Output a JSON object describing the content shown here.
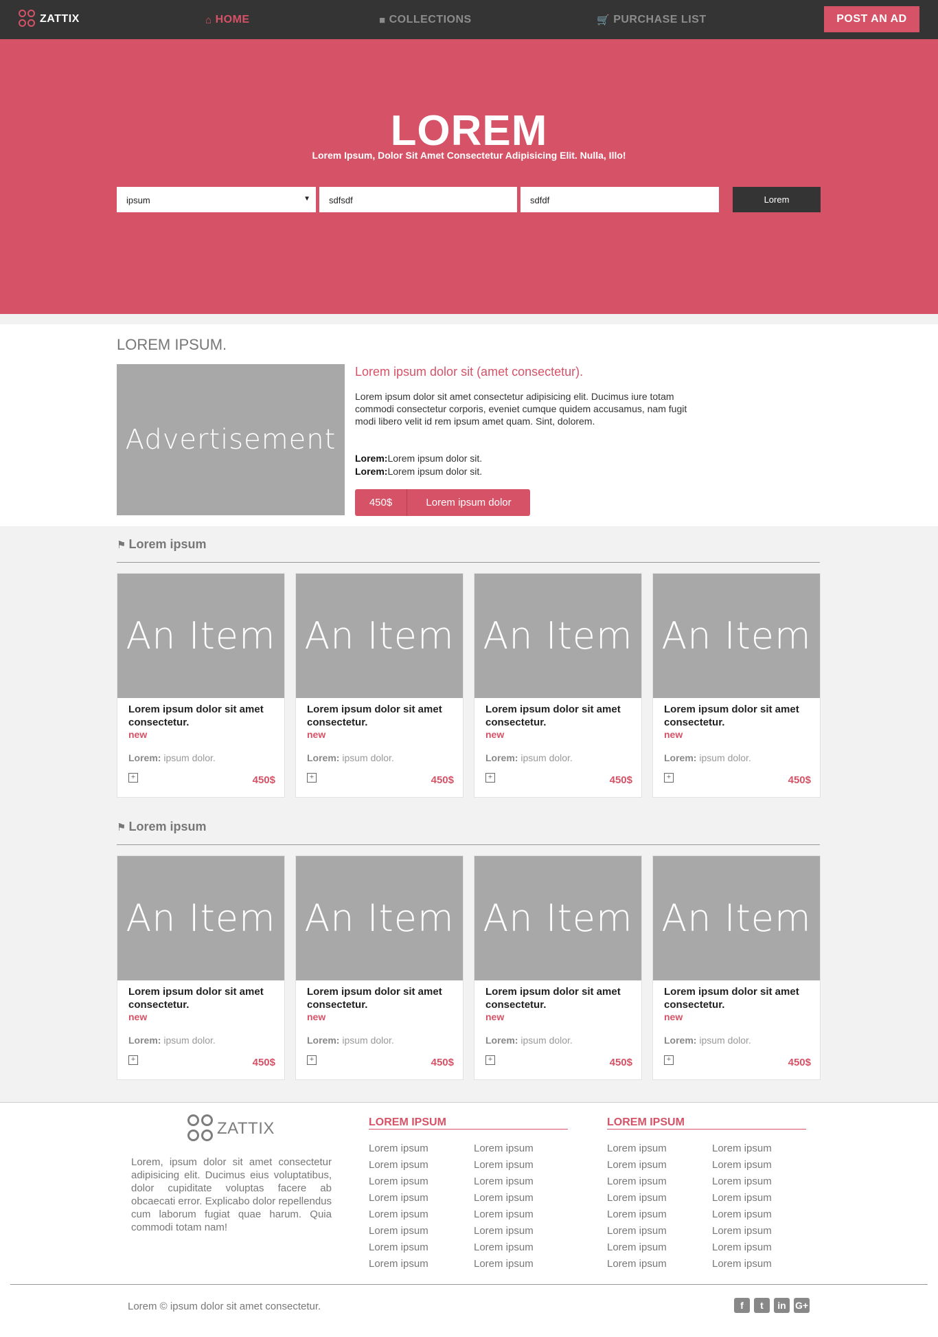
{
  "brand": {
    "name": "ZATTIX",
    "accent": "#d65266",
    "dark": "#343434"
  },
  "nav": {
    "home": "HOME",
    "collections": "COLLECTIONS",
    "purchase_list": "PURCHASE LIST",
    "post_ad": "POST AN AD",
    "icons": {
      "home": "home-icon",
      "collections": "square-icon",
      "purchase_list": "cart-icon"
    }
  },
  "hero": {
    "title": "LOREM",
    "subtitle": "Lorem Ipsum, Dolor Sit Amet Consectetur Adipisicing Elit. Nulla, Illo!",
    "select_value": "ipsum",
    "input1_value": "sdfsdf",
    "input2_value": "sdfdf",
    "button": "Lorem"
  },
  "featured": {
    "heading": "LOREM IPSUM.",
    "ad_label": "Advertisement",
    "title": "Lorem ipsum dolor sit (amet consectetur).",
    "description": "Lorem ipsum dolor sit amet consectetur adipisicing elit. Ducimus iure totam commodi consectetur corporis, eveniet cumque quidem accusamus, nam fugit modi libero velit id rem ipsum amet quam. Sint, dolorem.",
    "detail1_label": "Lorem:",
    "detail1_value": "Lorem ipsum dolor sit.",
    "detail2_label": "Lorem:",
    "detail2_value": "Lorem ipsum dolor sit.",
    "price": "450$",
    "cta": "Lorem ipsum dolor"
  },
  "sections": [
    {
      "title": "Lorem ipsum",
      "items": [
        {
          "image_label": "An Item",
          "title": "Lorem ipsum dolor sit amet consectetur.",
          "tag": "new",
          "meta_label": "Lorem:",
          "meta_value": "ipsum dolor.",
          "price": "450$"
        },
        {
          "image_label": "An Item",
          "title": "Lorem ipsum dolor sit amet consectetur.",
          "tag": "new",
          "meta_label": "Lorem:",
          "meta_value": "ipsum dolor.",
          "price": "450$"
        },
        {
          "image_label": "An Item",
          "title": "Lorem ipsum dolor sit amet consectetur.",
          "tag": "new",
          "meta_label": "Lorem:",
          "meta_value": "ipsum dolor.",
          "price": "450$"
        },
        {
          "image_label": "An Item",
          "title": "Lorem ipsum dolor sit amet consectetur.",
          "tag": "new",
          "meta_label": "Lorem:",
          "meta_value": "ipsum dolor.",
          "price": "450$"
        }
      ]
    },
    {
      "title": "Lorem ipsum",
      "items": [
        {
          "image_label": "An Item",
          "title": "Lorem ipsum dolor sit amet consectetur.",
          "tag": "new",
          "meta_label": "Lorem:",
          "meta_value": "ipsum dolor.",
          "price": "450$"
        },
        {
          "image_label": "An Item",
          "title": "Lorem ipsum dolor sit amet consectetur.",
          "tag": "new",
          "meta_label": "Lorem:",
          "meta_value": "ipsum dolor.",
          "price": "450$"
        },
        {
          "image_label": "An Item",
          "title": "Lorem ipsum dolor sit amet consectetur.",
          "tag": "new",
          "meta_label": "Lorem:",
          "meta_value": "ipsum dolor.",
          "price": "450$"
        },
        {
          "image_label": "An Item",
          "title": "Lorem ipsum dolor sit amet consectetur.",
          "tag": "new",
          "meta_label": "Lorem:",
          "meta_value": "ipsum dolor.",
          "price": "450$"
        }
      ]
    }
  ],
  "footer": {
    "logo_text": "ZATTIX",
    "about": "Lorem, ipsum dolor sit amet consectetur adipisicing elit. Ducimus eius voluptatibus, dolor cupiditate voluptas facere ab obcaecati error. Explicabo dolor repellendus cum laborum fugiat quae harum. Quia commodi totam nam!",
    "col1_heading": "LOREM IPSUM",
    "col2_heading": "LOREM IPSUM",
    "col1_links_a": [
      "Lorem ipsum",
      "Lorem ipsum",
      "Lorem ipsum",
      "Lorem ipsum",
      "Lorem ipsum",
      "Lorem ipsum",
      "Lorem ipsum",
      "Lorem ipsum"
    ],
    "col1_links_b": [
      "Lorem ipsum",
      "Lorem ipsum",
      "Lorem ipsum",
      "Lorem ipsum",
      "Lorem ipsum",
      "Lorem ipsum",
      "Lorem ipsum",
      "Lorem ipsum"
    ],
    "col2_links_a": [
      "Lorem ipsum",
      "Lorem ipsum",
      "Lorem ipsum",
      "Lorem ipsum",
      "Lorem ipsum",
      "Lorem ipsum",
      "Lorem ipsum",
      "Lorem ipsum"
    ],
    "col2_links_b": [
      "Lorem ipsum",
      "Lorem ipsum",
      "Lorem ipsum",
      "Lorem ipsum",
      "Lorem ipsum",
      "Lorem ipsum",
      "Lorem ipsum",
      "Lorem ipsum"
    ],
    "copyright": "Lorem © ipsum dolor sit amet consectetur.",
    "social": [
      {
        "icon": "facebook-icon",
        "glyph": "f"
      },
      {
        "icon": "twitter-icon",
        "glyph": "t"
      },
      {
        "icon": "linkedin-icon",
        "glyph": "in"
      },
      {
        "icon": "google-plus-icon",
        "glyph": "G+"
      }
    ]
  }
}
